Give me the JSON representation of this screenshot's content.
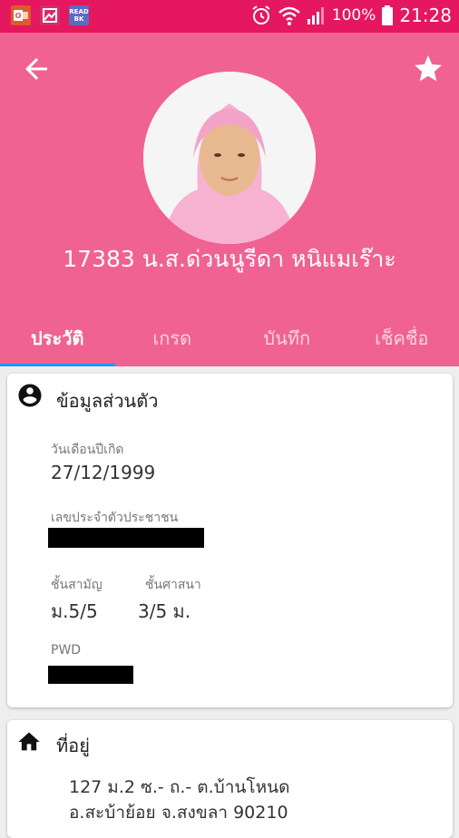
{
  "status_bar": {
    "app_icon_1": "office-icon",
    "app_icon_2": "gallery-icon",
    "app_icon_3_label": "READ BK",
    "battery": "100%",
    "time": "21:28",
    "accent_color": "#e5175f"
  },
  "header": {
    "color": "#f06292",
    "name": "17383 น.ส.ด่วนนูรีดา  หนิแมเร๊าะ",
    "back_icon": "arrow-back-icon",
    "favorite_icon": "star-icon"
  },
  "tabs": [
    {
      "label": "ประวัติ",
      "active": true
    },
    {
      "label": "เกรด",
      "active": false
    },
    {
      "label": "บันทึก",
      "active": false
    },
    {
      "label": "เช็คชื่อ",
      "active": false
    }
  ],
  "personal": {
    "title": "ข้อมูลส่วนตัว",
    "icon": "account-circle-icon",
    "dob_label": "วันเดือนปีเกิด",
    "dob_value": "27/12/1999",
    "id_label": "เลขประจำตัวประชาชน",
    "grade_label": "ชั้นสามัญ",
    "grade_value": "ม.5/5",
    "religious_label": "ชั้นศาสนา",
    "religious_value": "3/5 ม.",
    "pwd_label": "PWD"
  },
  "address": {
    "title": "ที่อยู่",
    "icon": "home-icon",
    "line1": "127 ม.2  ซ.-  ถ.-  ต.บ้านโหนด",
    "line2": "อ.สะบ้าย้อย  จ.สงขลา  90210"
  }
}
